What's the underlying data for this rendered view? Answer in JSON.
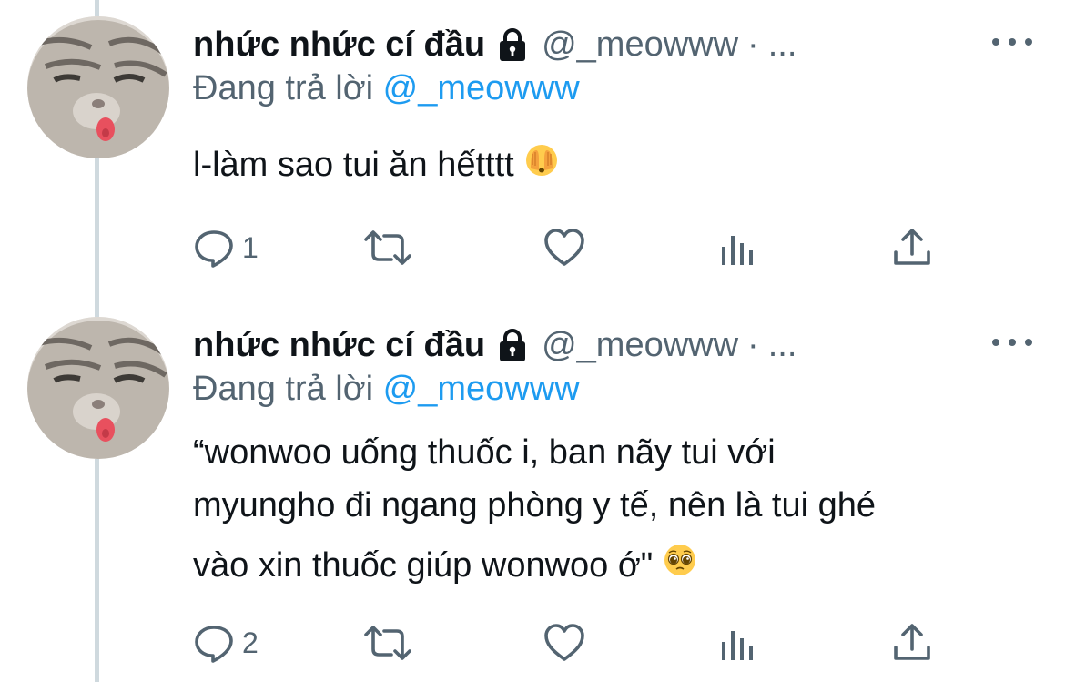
{
  "tweets": [
    {
      "display_name": "nhức nhức cí đầu",
      "handle": "@_meowww",
      "separator": "·",
      "truncated": "...",
      "reply_prefix": "Đang trả lời",
      "reply_to": "@_meowww",
      "body_lines": [
        "l-làm sao tui ăn hếtttt"
      ],
      "emoji": "face-with-hands-over-eyes",
      "reply_count": "1",
      "avatar": "cat-tongue-out"
    },
    {
      "display_name": "nhức nhức cí đầu",
      "handle": "@_meowww",
      "separator": "·",
      "truncated": "...",
      "reply_prefix": "Đang trả lời",
      "reply_to": "@_meowww",
      "body_lines": [
        "“wonwoo uống thuốc i, ban nãy tui với",
        "myungho đi ngang phòng y tế, nên là tui ghé",
        "vào xin thuốc giúp wonwoo ớ\""
      ],
      "emoji": "pleading-face",
      "reply_count": "2",
      "avatar": "cat-tongue-out"
    }
  ],
  "colors": {
    "text": "#0f1419",
    "muted": "#536471",
    "link": "#1d9bf0",
    "thread_line": "#cfd9de"
  },
  "icons": [
    "lock-icon",
    "more-icon",
    "reply-icon",
    "retweet-icon",
    "like-icon",
    "stats-icon",
    "share-icon"
  ]
}
